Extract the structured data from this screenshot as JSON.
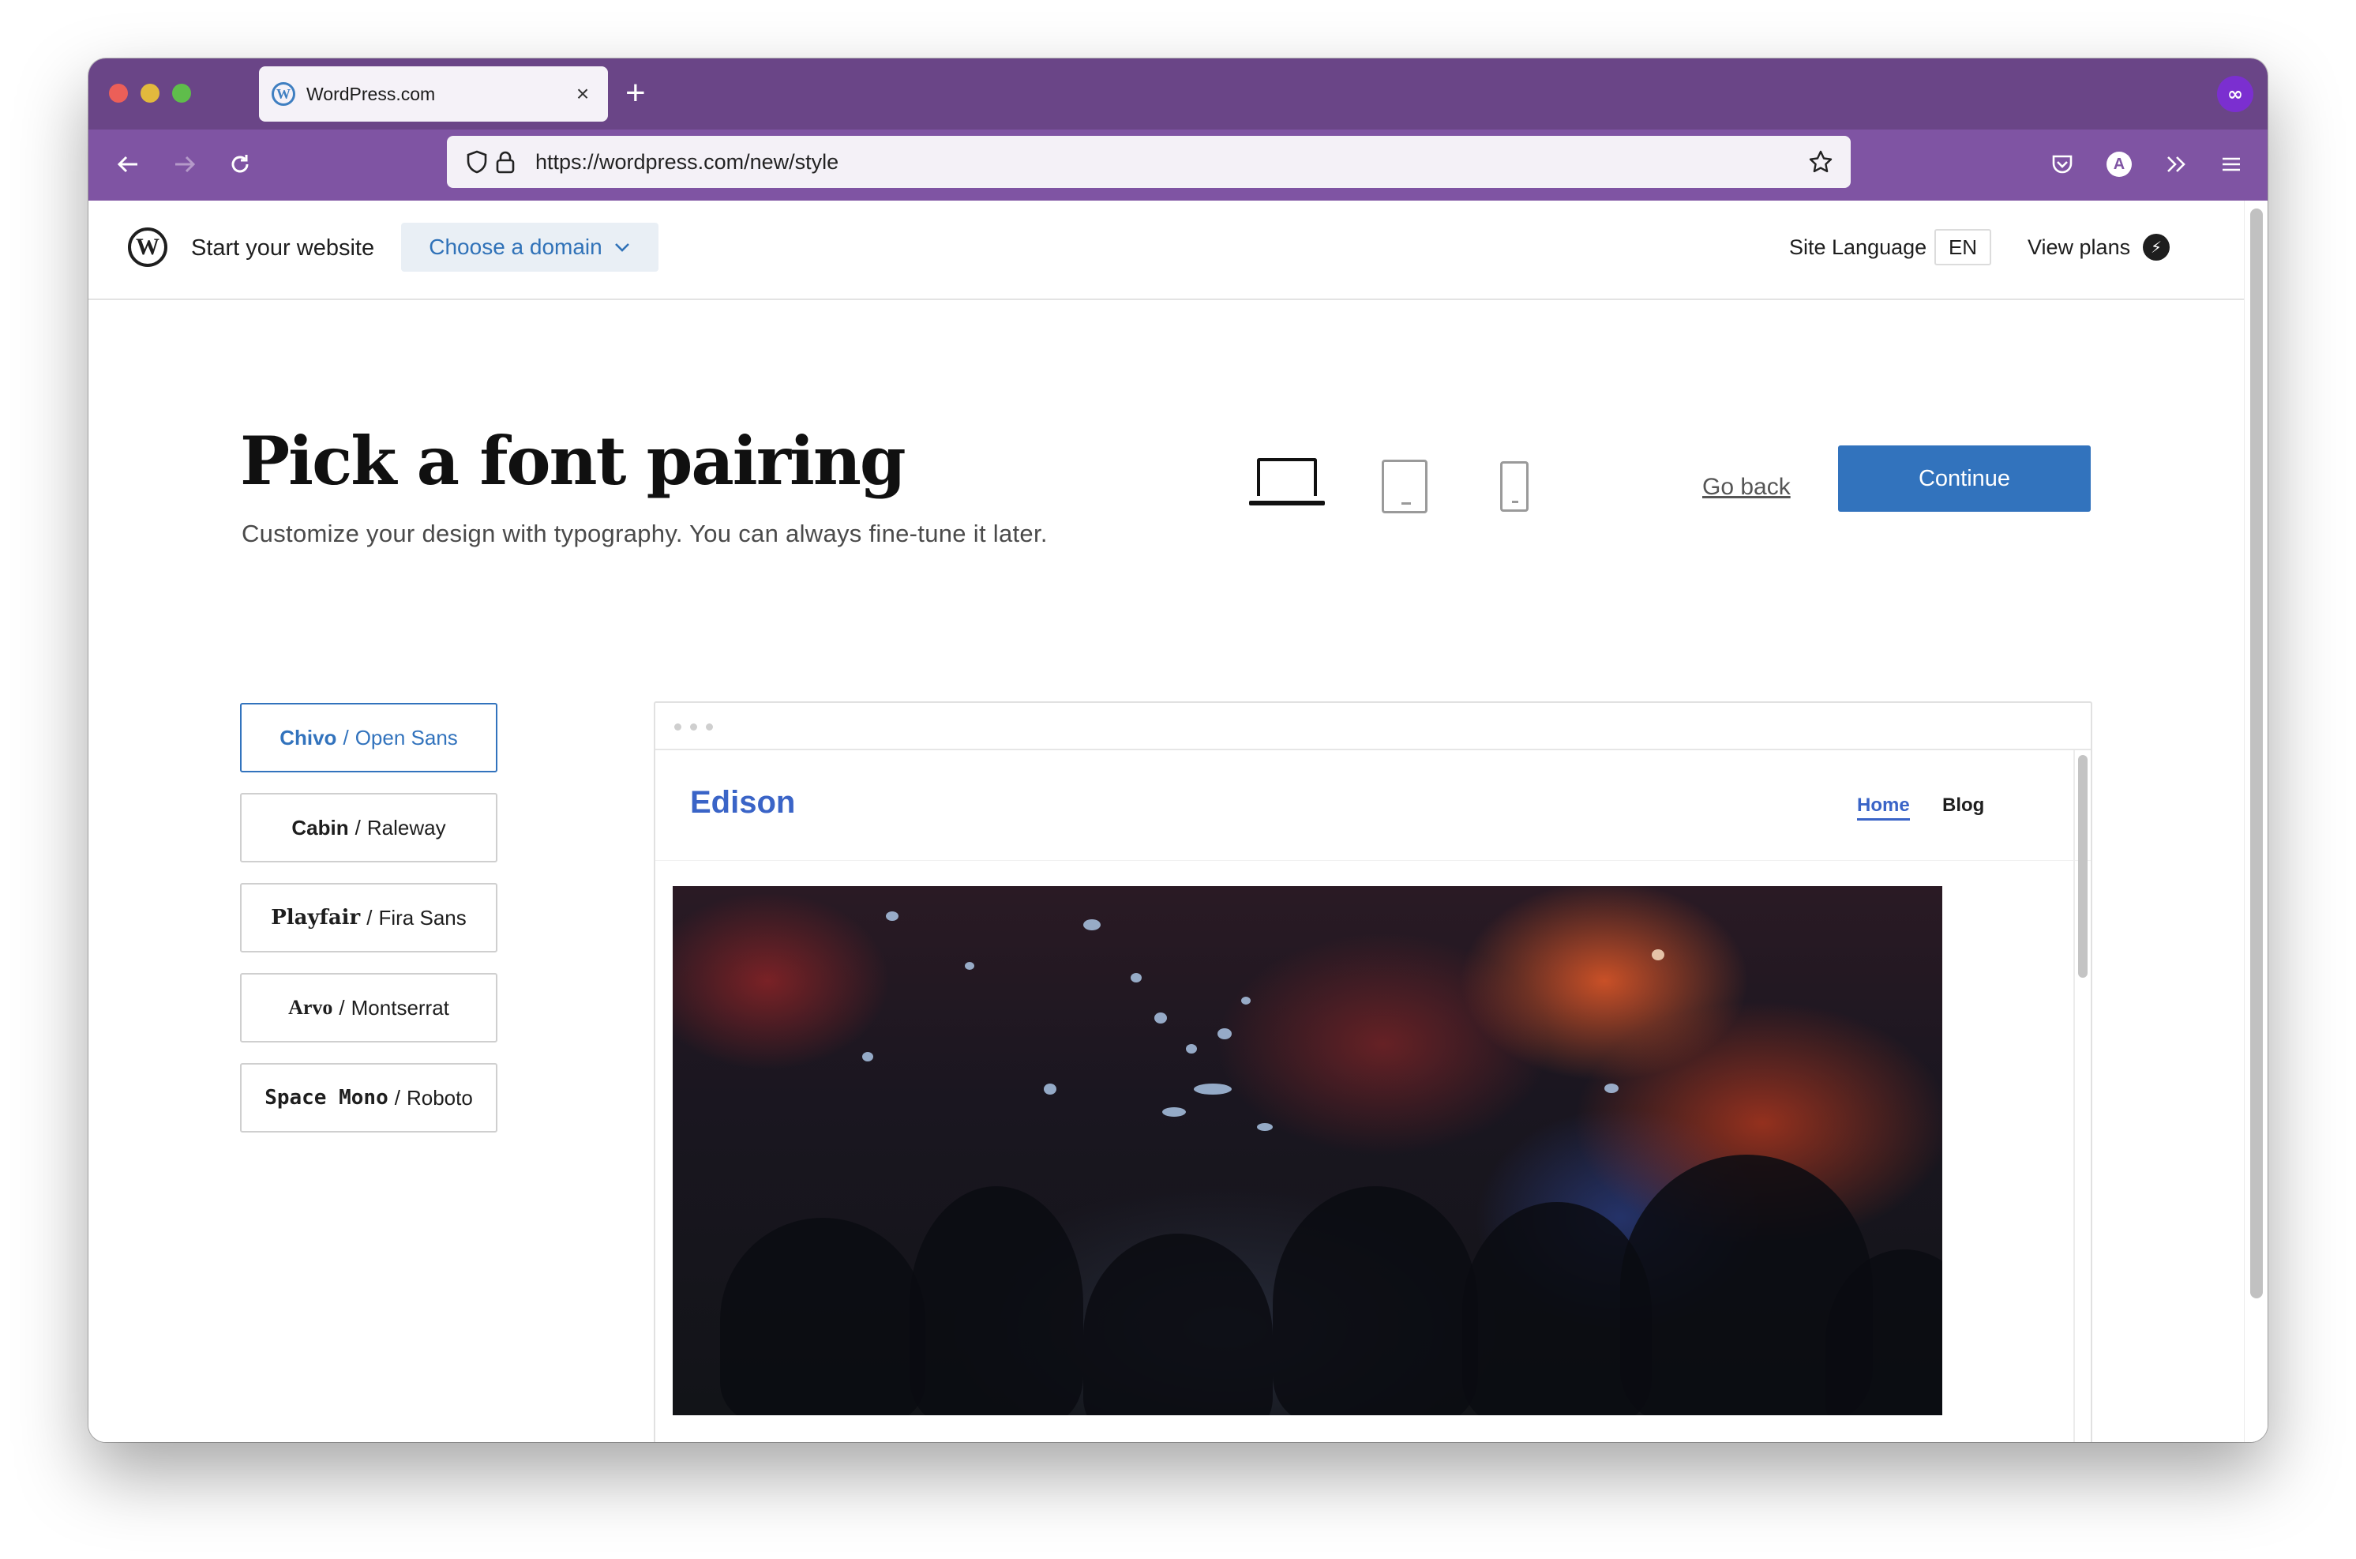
{
  "browser": {
    "tab_title": "WordPress.com",
    "tab_close": "×",
    "new_tab": "+",
    "url": "https://wordpress.com/new/style"
  },
  "header": {
    "start_label": "Start your website",
    "domain_button": "Choose a domain",
    "site_language_label": "Site Language",
    "site_language_value": "EN",
    "view_plans": "View plans"
  },
  "main": {
    "title": "Pick a font pairing",
    "subtitle": "Customize your design with typography. You can always fine-tune it later.",
    "go_back": "Go back",
    "continue": "Continue"
  },
  "font_options": [
    {
      "heading": "Chivo",
      "body": "Open Sans",
      "selected": true
    },
    {
      "heading": "Cabin",
      "body": "Raleway",
      "selected": false
    },
    {
      "heading": "Playfair",
      "body": "Fira Sans",
      "selected": false
    },
    {
      "heading": "Arvo",
      "body": "Montserrat",
      "selected": false
    },
    {
      "heading": "Space Mono",
      "body": "Roboto",
      "selected": false
    }
  ],
  "font_separator": "/",
  "preview": {
    "site_title": "Edison",
    "nav_home": "Home",
    "nav_blog": "Blog"
  },
  "colors": {
    "browser_tabbar": "#6a4587",
    "browser_navbar": "#7f54a3",
    "accent_blue": "#3273bd",
    "preview_link": "#3a64c7"
  }
}
